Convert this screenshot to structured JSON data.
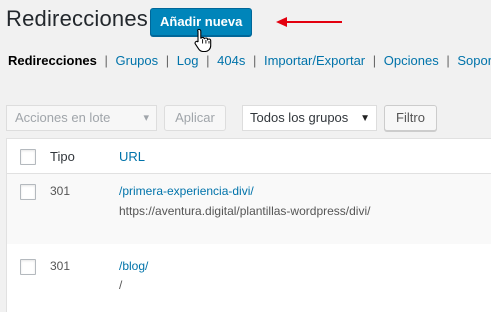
{
  "page": {
    "title": "Redirecciones",
    "add_button": "Añadir nueva"
  },
  "nav": {
    "items": [
      {
        "label": "Redirecciones",
        "current": true
      },
      {
        "label": "Grupos"
      },
      {
        "label": "Log"
      },
      {
        "label": "404s"
      },
      {
        "label": "Importar/Exportar"
      },
      {
        "label": "Opciones"
      },
      {
        "label": "Soporte"
      }
    ],
    "separator": "|"
  },
  "toolbar": {
    "bulk_actions": "Acciones en lote",
    "apply": "Aplicar",
    "group_select": "Todos los grupos",
    "filter": "Filtro"
  },
  "table": {
    "headers": {
      "type": "Tipo",
      "url": "URL"
    },
    "rows": [
      {
        "code": "301",
        "source": "/primera-experiencia-divi/",
        "target": "https://aventura.digital/plantillas-wordpress/divi/"
      },
      {
        "code": "301",
        "source": "/blog/",
        "target": "/"
      }
    ]
  },
  "colors": {
    "primary_button": "#0085ba",
    "link": "#0073aa",
    "annotation_arrow": "#e3000f"
  },
  "icons": [
    "pointer-hand-icon",
    "red-arrow-icon",
    "chevron-down-icon"
  ]
}
